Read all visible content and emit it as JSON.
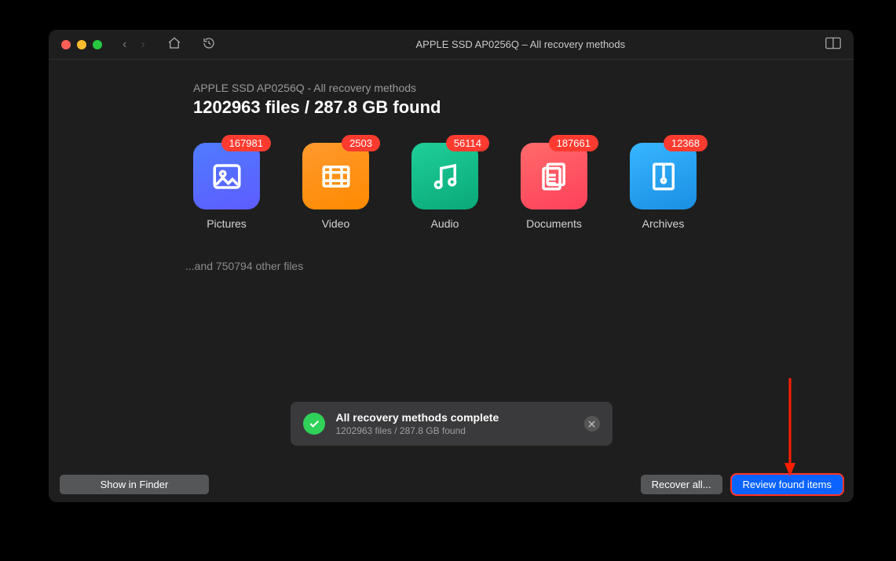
{
  "titlebar": {
    "title": "APPLE SSD AP0256Q – All recovery methods"
  },
  "header": {
    "subhead": "APPLE SSD AP0256Q - All recovery methods",
    "summary": "1202963 files / 287.8 GB found"
  },
  "categories": [
    {
      "id": "pictures",
      "label": "Pictures",
      "count": "167981",
      "gradient": "g-pictures"
    },
    {
      "id": "video",
      "label": "Video",
      "count": "2503",
      "gradient": "g-video"
    },
    {
      "id": "audio",
      "label": "Audio",
      "count": "56114",
      "gradient": "g-audio"
    },
    {
      "id": "documents",
      "label": "Documents",
      "count": "187661",
      "gradient": "g-docs"
    },
    {
      "id": "archives",
      "label": "Archives",
      "count": "12368",
      "gradient": "g-arch"
    }
  ],
  "other_files_line": "...and 750794 other files",
  "toast": {
    "title": "All recovery methods complete",
    "subtitle": "1202963 files / 287.8 GB found"
  },
  "footer": {
    "show_in_finder": "Show in Finder",
    "recover_all": "Recover all...",
    "review": "Review found items"
  }
}
